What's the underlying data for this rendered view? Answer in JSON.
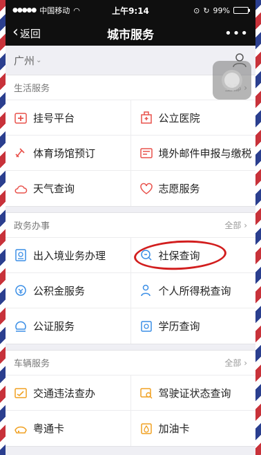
{
  "status_bar": {
    "carrier": "中国移动",
    "time": "上午9:14",
    "battery": "99%",
    "battery_level": 0.99
  },
  "nav": {
    "back_label": "返回",
    "title": "城市服务",
    "more": "•••"
  },
  "city": {
    "name": "广州"
  },
  "sections": [
    {
      "title": "生活服务",
      "all_label": "全部",
      "items": [
        {
          "label": "挂号平台",
          "icon": "hospital-plus-icon"
        },
        {
          "label": "公立医院",
          "icon": "hospital-building-icon"
        },
        {
          "label": "体育场馆预订",
          "icon": "sports-icon"
        },
        {
          "label": "境外邮件申报与缴税",
          "icon": "mail-declare-icon"
        },
        {
          "label": "天气查询",
          "icon": "weather-icon"
        },
        {
          "label": "志愿服务",
          "icon": "heart-icon"
        }
      ]
    },
    {
      "title": "政务办事",
      "all_label": "全部",
      "items": [
        {
          "label": "出入境业务办理",
          "icon": "passport-icon"
        },
        {
          "label": "社保查询",
          "icon": "social-security-icon"
        },
        {
          "label": "公积金服务",
          "icon": "housing-fund-icon"
        },
        {
          "label": "个人所得税查询",
          "icon": "tax-person-icon"
        },
        {
          "label": "公证服务",
          "icon": "notary-icon"
        },
        {
          "label": "学历查询",
          "icon": "education-icon"
        }
      ]
    },
    {
      "title": "车辆服务",
      "all_label": "全部",
      "items": [
        {
          "label": "交通违法查办",
          "icon": "traffic-violation-icon"
        },
        {
          "label": "驾驶证状态查询",
          "icon": "license-search-icon"
        },
        {
          "label": "粤通卡",
          "icon": "card-icon"
        },
        {
          "label": "加油卡",
          "icon": "fuel-card-icon"
        }
      ]
    }
  ],
  "colors": {
    "icon_orange": "#f0a020",
    "icon_red": "#e8504a",
    "icon_blue": "#3a8ee6",
    "highlight_circle": "#d21e1e"
  }
}
